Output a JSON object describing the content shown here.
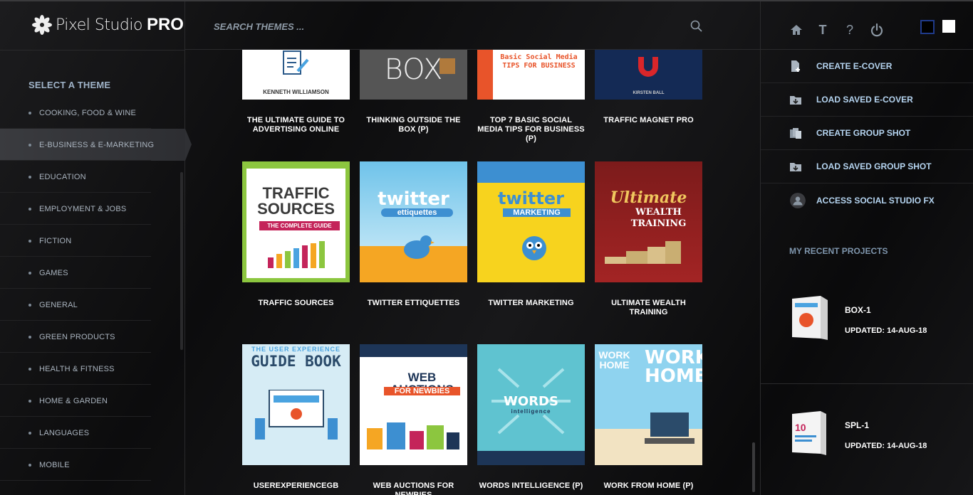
{
  "app": {
    "logo_name": "Pixel Studio",
    "logo_pro": "PRO"
  },
  "search": {
    "placeholder": "SEARCH THEMES ..."
  },
  "sidebar": {
    "title": "SELECT A THEME",
    "items": [
      {
        "label": "COOKING, FOOD & WINE",
        "active": false
      },
      {
        "label": "E-BUSINESS & E-MARKETING",
        "active": true
      },
      {
        "label": "EDUCATION",
        "active": false
      },
      {
        "label": "EMPLOYMENT & JOBS",
        "active": false
      },
      {
        "label": "FICTION",
        "active": false
      },
      {
        "label": "GAMES",
        "active": false
      },
      {
        "label": "GENERAL",
        "active": false
      },
      {
        "label": "GREEN PRODUCTS",
        "active": false
      },
      {
        "label": "HEALTH & FITNESS",
        "active": false
      },
      {
        "label": "HOME & GARDEN",
        "active": false
      },
      {
        "label": "LANGUAGES",
        "active": false
      },
      {
        "label": "MOBILE",
        "active": false
      }
    ]
  },
  "themes": {
    "row1": [
      {
        "caption": "THE ULTIMATE GUIDE TO ADVERTISING ONLINE",
        "cover_text": "KENNETH WILLIAMSON"
      },
      {
        "caption": "THINKING OUTSIDE THE BOX (P)",
        "cover_text": "BOX"
      },
      {
        "caption": "TOP 7 BASIC SOCIAL MEDIA TIPS FOR BUSINESS (P)",
        "cover_text": "Basic Social Media TIPS FOR BUSINESS"
      },
      {
        "caption": "TRAFFIC MAGNET PRO",
        "cover_text": "KIRSTEN BALL"
      }
    ],
    "row2": [
      {
        "caption": "TRAFFIC SOURCES",
        "cover_text": "TRAFFIC SOURCES",
        "cover_sub": "THE COMPLETE GUIDE"
      },
      {
        "caption": "TWITTER ETTIQUETTES",
        "cover_text": "twitter",
        "cover_sub": "ettiquettes"
      },
      {
        "caption": "TWITTER MARKETING",
        "cover_text": "twitter",
        "cover_sub": "MARKETING"
      },
      {
        "caption": "ULTIMATE WEALTH TRAINING",
        "cover_text": "Ultimate",
        "cover_sub": "WEALTH TRAINING"
      }
    ],
    "row3": [
      {
        "caption": "USEREXPERIENCEGB",
        "cover_text": "GUIDE BOOK",
        "cover_sub": "THE USER EXPERIENCE"
      },
      {
        "caption": "WEB AUCTIONS FOR NEWBIES",
        "cover_text": "WEB AUCTIONS",
        "cover_sub": "FOR NEWBIES"
      },
      {
        "caption": "WORDS INTELLIGENCE (P)",
        "cover_text": "WORDS",
        "cover_sub": "intelligence"
      },
      {
        "caption": "WORK FROM HOME (P)",
        "cover_text": "WORK HOME",
        "cover_sub": "WORK HOME"
      }
    ]
  },
  "actions": [
    {
      "label": "CREATE E-COVER",
      "icon": "new-file-icon"
    },
    {
      "label": "LOAD SAVED E-COVER",
      "icon": "load-folder-icon"
    },
    {
      "label": "CREATE GROUP SHOT",
      "icon": "group-files-icon"
    },
    {
      "label": "LOAD SAVED GROUP SHOT",
      "icon": "load-folder-icon"
    },
    {
      "label": "ACCESS SOCIAL STUDIO FX",
      "icon": "social-fx-icon"
    }
  ],
  "top_icons": [
    "home-icon",
    "text-icon",
    "help-icon",
    "power-icon"
  ],
  "top_icon_glyphs": {
    "text": "T",
    "help": "?"
  },
  "recent": {
    "title": "MY RECENT PROJECTS",
    "items": [
      {
        "name": "BOX-1",
        "date": "UPDATED: 14-AUG-18"
      },
      {
        "name": "SPL-1",
        "date": "UPDATED: 14-AUG-18"
      }
    ]
  },
  "colors": {
    "accent": "#b5d4f0",
    "sidebar_active": "#3a3b3f",
    "background": "#111111"
  }
}
